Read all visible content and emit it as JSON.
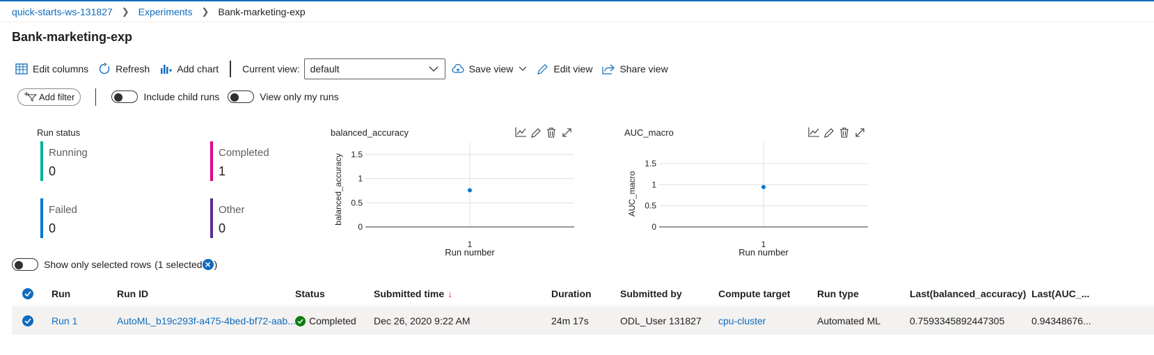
{
  "breadcrumb": {
    "workspace": "quick-starts-ws-131827",
    "experiments": "Experiments",
    "current": "Bank-marketing-exp"
  },
  "page_title": "Bank-marketing-exp",
  "toolbar": {
    "edit_columns": "Edit columns",
    "refresh": "Refresh",
    "add_chart": "Add chart",
    "current_view_label": "Current view:",
    "current_view_value": "default",
    "save_view": "Save view",
    "edit_view": "Edit view",
    "share_view": "Share view"
  },
  "filters": {
    "add_filter": "Add filter",
    "include_child_runs": "Include child runs",
    "view_only_my_runs": "View only my runs"
  },
  "run_status": {
    "title": "Run status",
    "items": [
      {
        "label": "Running",
        "value": "0",
        "color": "#00b294"
      },
      {
        "label": "Completed",
        "value": "1",
        "color": "#e3008c"
      },
      {
        "label": "Failed",
        "value": "0",
        "color": "#0078d4"
      },
      {
        "label": "Other",
        "value": "0",
        "color": "#5c2d91"
      }
    ]
  },
  "chart_data": [
    {
      "type": "scatter",
      "title": "balanced_accuracy",
      "xlabel": "Run number",
      "ylabel": "balanced_accuracy",
      "x": [
        1
      ],
      "y": [
        0.759
      ],
      "xticks": [
        "1"
      ],
      "yticks": [
        "0",
        "0.5",
        "1",
        "1.5"
      ],
      "ylim": [
        0,
        1.5
      ],
      "grid": true,
      "color": "#0078d4"
    },
    {
      "type": "scatter",
      "title": "AUC_macro",
      "xlabel": "Run number",
      "ylabel": "AUC_macro",
      "x": [
        1
      ],
      "y": [
        0.943
      ],
      "xticks": [
        "1"
      ],
      "yticks": [
        "0",
        "0.5",
        "1",
        "1.5"
      ],
      "ylim": [
        0,
        1.5
      ],
      "grid": true,
      "color": "#0078d4"
    }
  ],
  "selection": {
    "label": "Show only selected rows",
    "count_prefix": "(1 selected",
    "count_suffix": ")"
  },
  "table": {
    "headers": [
      "Run",
      "Run ID",
      "Status",
      "Submitted time",
      "Duration",
      "Submitted by",
      "Compute target",
      "Run type",
      "Last(balanced_accuracy)",
      "Last(AUC_..."
    ],
    "sort_arrow": "↓",
    "rows": [
      [
        "Run 1",
        "AutoML_b19c293f-a475-4bed-bf72-aab...",
        "Completed",
        "Dec 26, 2020 9:22 AM",
        "24m 17s",
        "ODL_User 131827",
        "cpu-cluster",
        "Automated ML",
        "0.7593345892447305",
        "0.94348676..."
      ]
    ]
  },
  "colors": {
    "accent": "#0f6cbd",
    "success": "#107c10"
  }
}
